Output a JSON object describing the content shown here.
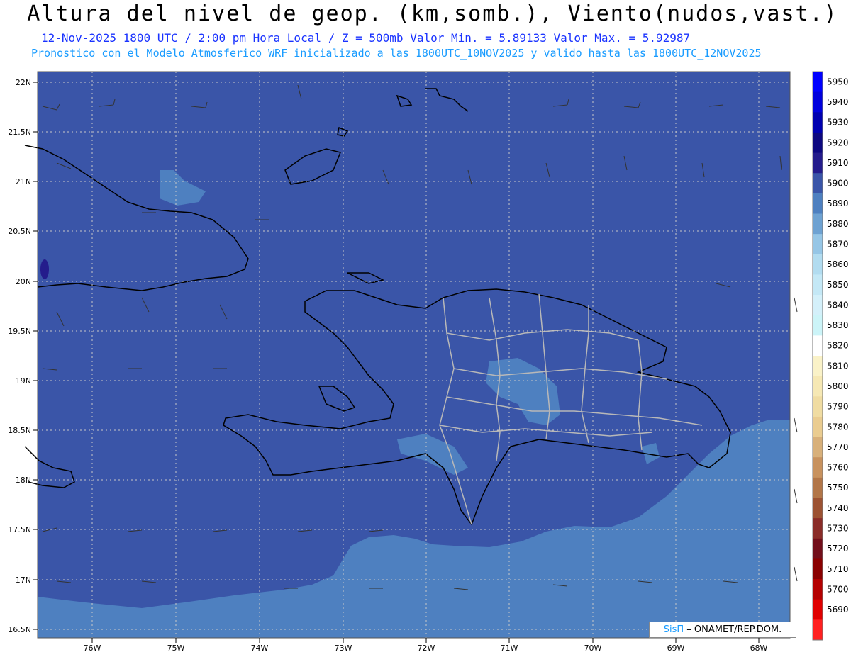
{
  "header": {
    "title": "Altura del nivel de geop. (km,somb.), Viento(nudos,vast.)",
    "date": "12-Nov-2025",
    "time": "1800 UTC / 2:00 pm Hora Local / Z = 500mb",
    "min": "Valor Min. = 5.89133",
    "max": "Valor Max. = 5.92987",
    "forecast": "Pronostico con el Modelo Atmosferico WRF inicializado a las 1800UTC_10NOV2025 y valido hasta las  1800UTC_12NOV2025"
  },
  "axes": {
    "lat_labels": [
      "22N",
      "21.5N",
      "21N",
      "20.5N",
      "20N",
      "19.5N",
      "19N",
      "18.5N",
      "18N",
      "17.5N",
      "17N",
      "16.5N"
    ],
    "lon_labels": [
      "76W",
      "75W",
      "74W",
      "73W",
      "72W",
      "71W",
      "70W",
      "69W",
      "68W"
    ]
  },
  "colorbar": {
    "labels": [
      "5950",
      "5940",
      "5930",
      "5920",
      "5910",
      "5900",
      "5890",
      "5880",
      "5870",
      "5860",
      "5850",
      "5840",
      "5830",
      "5820",
      "5810",
      "5800",
      "5790",
      "5780",
      "5770",
      "5760",
      "5750",
      "5740",
      "5730",
      "5720",
      "5710",
      "5700",
      "5690"
    ],
    "colors": [
      "#0000ff",
      "#0000dd",
      "#0000b0",
      "#0d0880",
      "#241c8c",
      "#3a55a8",
      "#4e80c0",
      "#6ea2d2",
      "#96c6e6",
      "#b2dcf0",
      "#c4e8f6",
      "#d4f0fa",
      "#ccf4f8",
      "#ffffff",
      "#faf2c8",
      "#f6e8b4",
      "#f0dca2",
      "#eacc90",
      "#d8b07a",
      "#c8925e",
      "#b27648",
      "#9c5232",
      "#8a2c28",
      "#720e1a",
      "#8a0000",
      "#b40000",
      "#e00000",
      "#ff2020"
    ],
    "shade_deep": "#3a55a8",
    "shade_light": "#4e80c0"
  },
  "credit": {
    "logo": "SisΠ",
    "text": "– ONAMET/REP.DOM."
  }
}
